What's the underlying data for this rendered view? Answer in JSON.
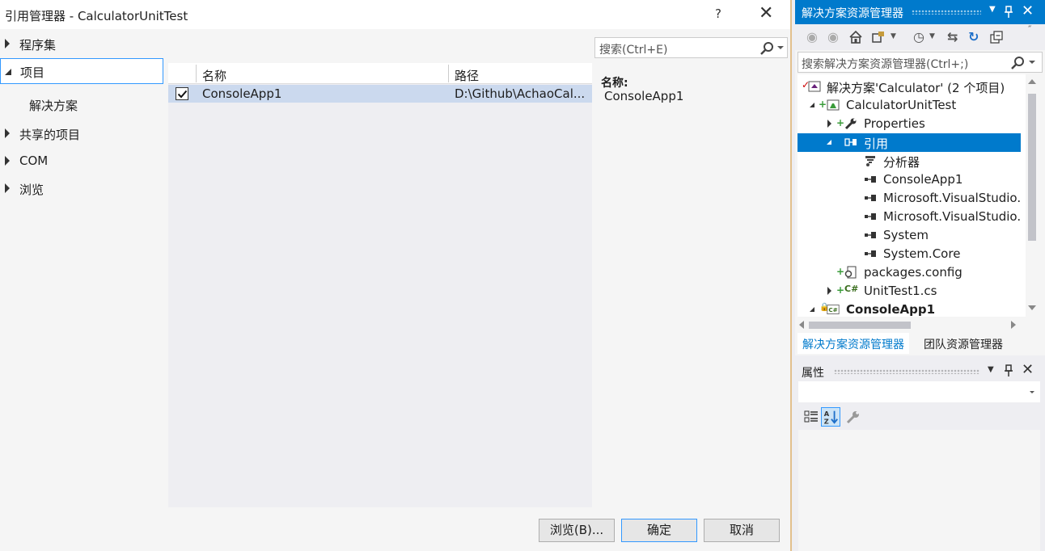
{
  "dialog": {
    "title": "引用管理器 - CalculatorUnitTest",
    "help": "?",
    "close": "✕",
    "nav": [
      {
        "label": "程序集",
        "expanded": false
      },
      {
        "label": "项目",
        "expanded": true,
        "selected": true
      },
      {
        "label": "共享的项目",
        "expanded": false
      },
      {
        "label": "COM",
        "expanded": false
      },
      {
        "label": "浏览",
        "expanded": false
      }
    ],
    "nav_sub": "解决方案",
    "search_placeholder": "搜索(Ctrl+E)",
    "columns": {
      "name": "名称",
      "path": "路径"
    },
    "rows": [
      {
        "checked": true,
        "name": "ConsoleApp1",
        "path": "D:\\Github\\AchaoCal..."
      }
    ],
    "detail": {
      "label": "名称:",
      "value": "ConsoleApp1"
    },
    "buttons": {
      "browse": "浏览(B)...",
      "ok": "确定",
      "cancel": "取消"
    }
  },
  "solution_explorer": {
    "title": "解决方案资源管理器",
    "search_placeholder": "搜索解决方案资源管理器(Ctrl+;)",
    "tree": [
      {
        "label": "解决方案'Calculator' (2 个项目)",
        "icon": "solution-icon"
      },
      {
        "label": "CalculatorUnitTest",
        "icon": "test-project-icon"
      },
      {
        "label": "Properties",
        "icon": "wrench-icon"
      },
      {
        "label": "引用",
        "icon": "references-icon",
        "selected": true
      },
      {
        "label": "分析器",
        "icon": "analyzer-icon"
      },
      {
        "label": "ConsoleApp1",
        "icon": "reference-icon"
      },
      {
        "label": "Microsoft.VisualStudio.",
        "icon": "reference-icon"
      },
      {
        "label": "Microsoft.VisualStudio.",
        "icon": "reference-icon"
      },
      {
        "label": "System",
        "icon": "reference-icon"
      },
      {
        "label": "System.Core",
        "icon": "reference-icon"
      },
      {
        "label": "packages.config",
        "icon": "config-icon"
      },
      {
        "label": "UnitTest1.cs",
        "icon": "csharp-file-icon"
      },
      {
        "label": "ConsoleApp1",
        "icon": "csharp-project-icon"
      }
    ],
    "tabs": [
      "解决方案资源管理器",
      "团队资源管理器"
    ],
    "colors": {
      "accent": "#007acc",
      "selection": "#007acc"
    }
  },
  "properties": {
    "title": "属性"
  }
}
